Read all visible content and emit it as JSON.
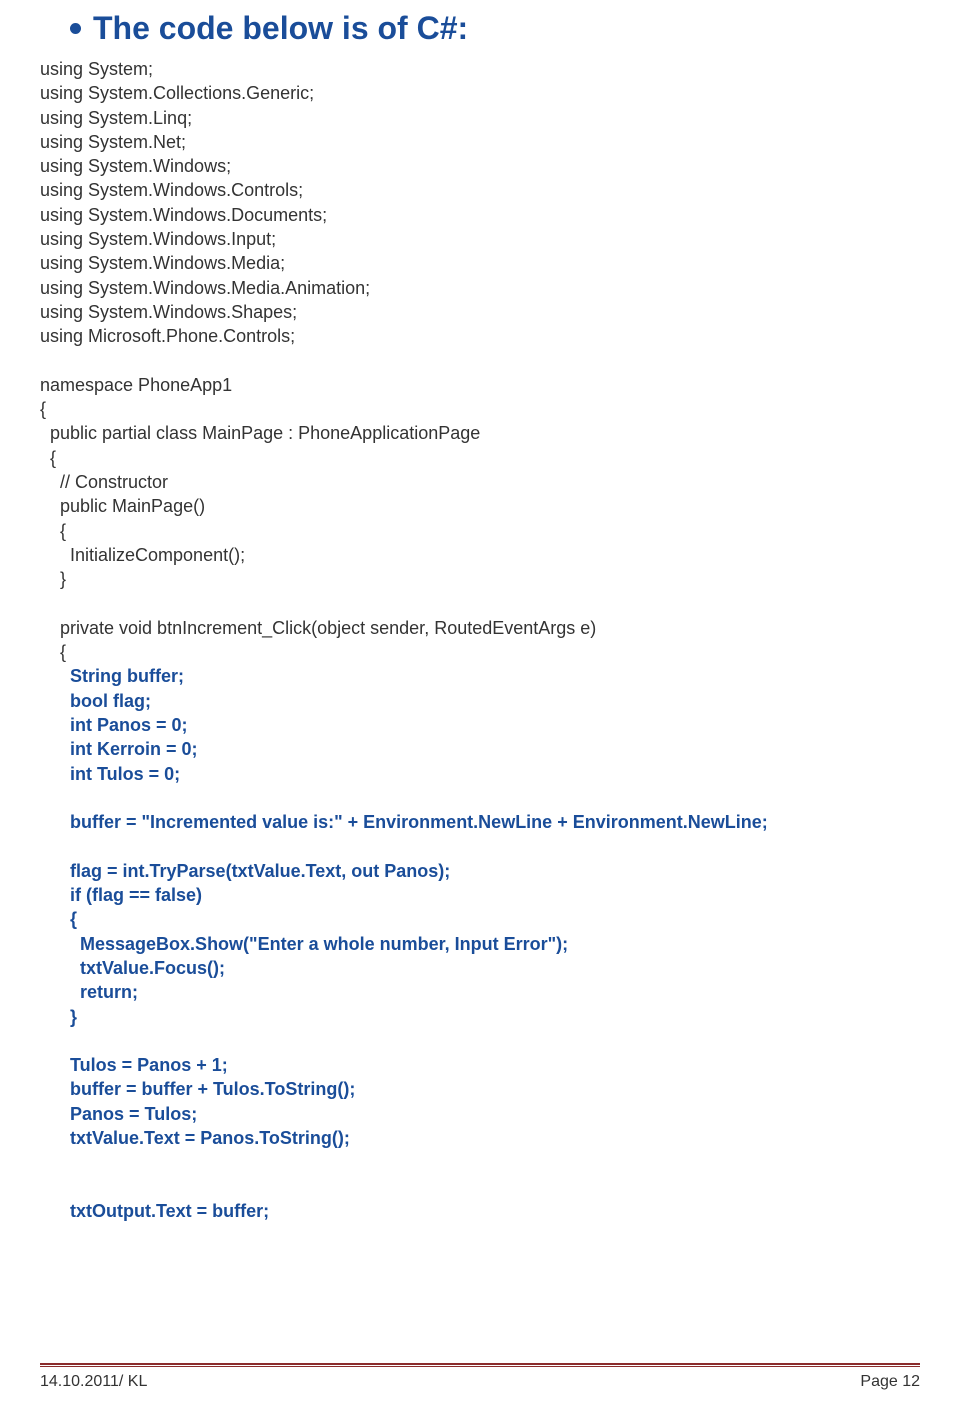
{
  "heading": "The code below is of C#:",
  "code": {
    "usings": [
      "using System;",
      "using System.Collections.Generic;",
      "using System.Linq;",
      "using System.Net;",
      "using System.Windows;",
      "using System.Windows.Controls;",
      "using System.Windows.Documents;",
      "using System.Windows.Input;",
      "using System.Windows.Media;",
      "using System.Windows.Media.Animation;",
      "using System.Windows.Shapes;",
      "using Microsoft.Phone.Controls;"
    ],
    "ns_open": "namespace PhoneApp1",
    "brace_open": "{",
    "class_decl": "  public partial class MainPage : PhoneApplicationPage",
    "class_open": "  {",
    "ctor_comment": "    // Constructor",
    "ctor_decl": "    public MainPage()",
    "ctor_open": "    {",
    "ctor_body": "      InitializeComponent();",
    "ctor_close": "    }",
    "ev_decl": "    private void btnIncrement_Click(object sender, RoutedEventArgs e)",
    "ev_open": "    {",
    "v1": "      String buffer;",
    "v2": "      bool flag;",
    "v3": "      int Panos = 0;",
    "v4": "      int Kerroin = 0;",
    "v5": "      int Tulos = 0;",
    "buf": "      buffer = \"Incremented value is:\" + Environment.NewLine + Environment.NewLine;",
    "flag": "      flag = int.TryParse(txtValue.Text, out Panos);",
    "if1": "      if (flag == false)",
    "if_open": "      {",
    "mb": "        MessageBox.Show(\"Enter a whole number, Input Error\");",
    "focus": "        txtValue.Focus();",
    "ret": "        return;",
    "if_close": "      }",
    "t1": "      Tulos = Panos + 1;",
    "t2": "      buffer = buffer + Tulos.ToString();",
    "t3": "      Panos = Tulos;",
    "t4": "      txtValue.Text = Panos.ToString();",
    "out": "      txtOutput.Text = buffer;"
  },
  "footer": {
    "left": "14.10.2011/ KL",
    "right": "Page 12"
  }
}
